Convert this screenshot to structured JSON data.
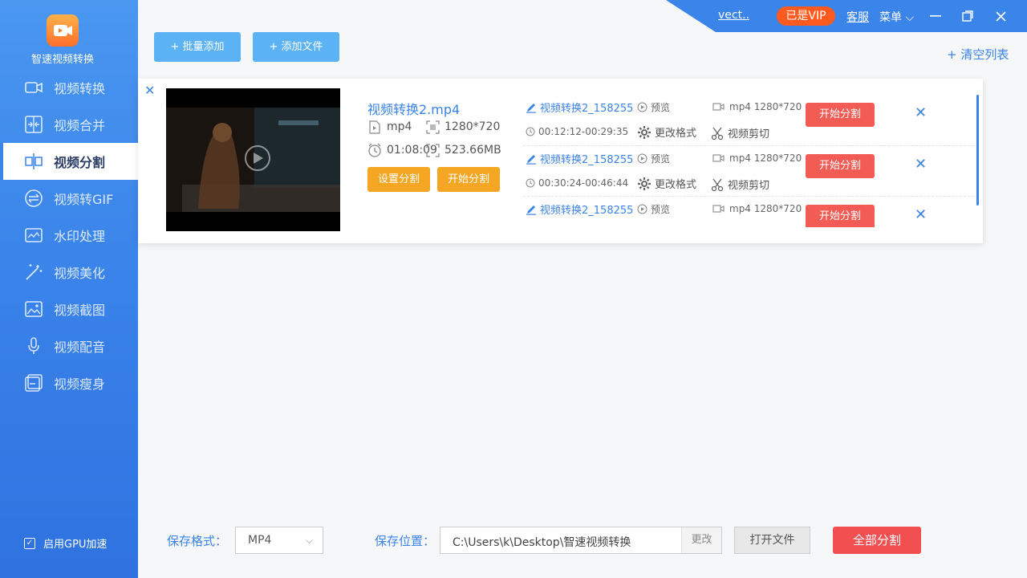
{
  "app": {
    "title": "智速视频转换"
  },
  "topbar": {
    "user": "vect..",
    "vip_badge": "已是VIP",
    "service": "客服",
    "menu": "菜单"
  },
  "sidebar": {
    "items": [
      {
        "label": "视频转换",
        "icon": "video-camera-icon"
      },
      {
        "label": "视频合并",
        "icon": "merge-icon"
      },
      {
        "label": "视频分割",
        "icon": "split-icon",
        "active": true
      },
      {
        "label": "视频转GIF",
        "icon": "gif-convert-icon"
      },
      {
        "label": "水印处理",
        "icon": "watermark-icon"
      },
      {
        "label": "视频美化",
        "icon": "magic-wand-icon"
      },
      {
        "label": "视频截图",
        "icon": "image-icon"
      },
      {
        "label": "视频配音",
        "icon": "microphone-icon"
      },
      {
        "label": "视频瘦身",
        "icon": "compress-icon"
      }
    ],
    "gpu_label": "启用GPU加速",
    "gpu_checked": true
  },
  "toolbar": {
    "batch_add": "+ 批量添加",
    "add_file": "+ 添加文件",
    "clear_list": "+ 清空列表"
  },
  "file": {
    "name": "视频转换2.mp4",
    "format": "mp4",
    "resolution": "1280*720",
    "duration": "01:08:09",
    "size": "523.66MB",
    "set_split": "设置分割",
    "start_split": "开始分割"
  },
  "segments": [
    {
      "name": "视频转换2_158255",
      "preview": "预览",
      "format": "mp4 1280*720",
      "time": "00:12:12-00:29:35",
      "change_format": "更改格式",
      "cut": "视频剪切",
      "start": "开始分割"
    },
    {
      "name": "视频转换2_158255",
      "preview": "预览",
      "format": "mp4 1280*720",
      "time": "00:30:24-00:46:44",
      "change_format": "更改格式",
      "cut": "视频剪切",
      "start": "开始分割"
    },
    {
      "name": "视频转换2_158255",
      "preview": "预览",
      "format": "mp4 1280*720",
      "start": "开始分割"
    }
  ],
  "bottom": {
    "format_label": "保存格式：",
    "format_value": "MP4",
    "location_label": "保存位置：",
    "location_value": "C:\\Users\\k\\Desktop\\智速视频转换",
    "change": "更改",
    "open_file": "打开文件",
    "split_all": "全部分割"
  },
  "colors": {
    "accent": "#3a84ea",
    "orange": "#f5a623",
    "red": "#f25c54",
    "vip": "#ff5a1f"
  }
}
